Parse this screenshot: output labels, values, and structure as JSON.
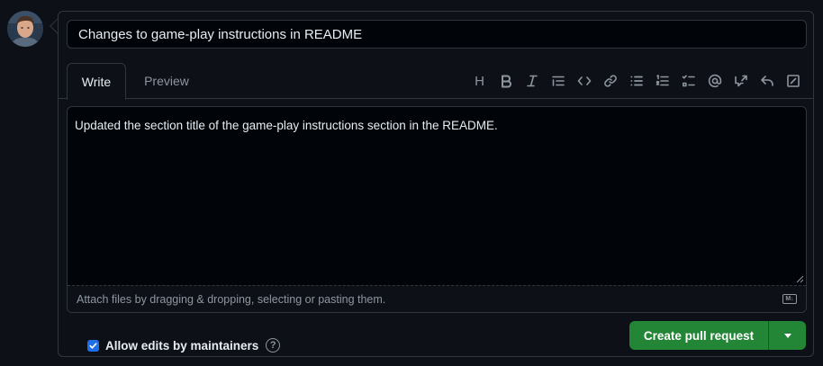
{
  "pr_form": {
    "title_value": "Changes to game-play instructions in README",
    "title_placeholder": "Title"
  },
  "tabs": [
    {
      "label": "Write",
      "active": true
    },
    {
      "label": "Preview",
      "active": false
    }
  ],
  "toolbar": {
    "heading_glyph": "H",
    "icons": [
      "heading-icon",
      "bold-icon",
      "italic-icon",
      "quote-icon",
      "code-icon",
      "link-icon",
      "bulleted-list-icon",
      "numbered-list-icon",
      "task-list-icon",
      "mention-icon",
      "cross-reference-icon",
      "reply-icon",
      "fullscreen-icon"
    ]
  },
  "editor": {
    "body_text": "Updated the section title of the game-play instructions section in the README.",
    "attach_hint": "Attach files by dragging & dropping, selecting or pasting them.",
    "markdown_badge": "M↓"
  },
  "options": {
    "allow_edits_label": "Allow edits by maintainers",
    "allow_edits_checked": true,
    "help_glyph": "?"
  },
  "actions": {
    "create_label": "Create pull request"
  },
  "colors": {
    "background": "#0d1117",
    "border": "#30363d",
    "primary_button": "#238636",
    "checkbox": "#1f6feb",
    "muted_text": "#8d96a0"
  }
}
